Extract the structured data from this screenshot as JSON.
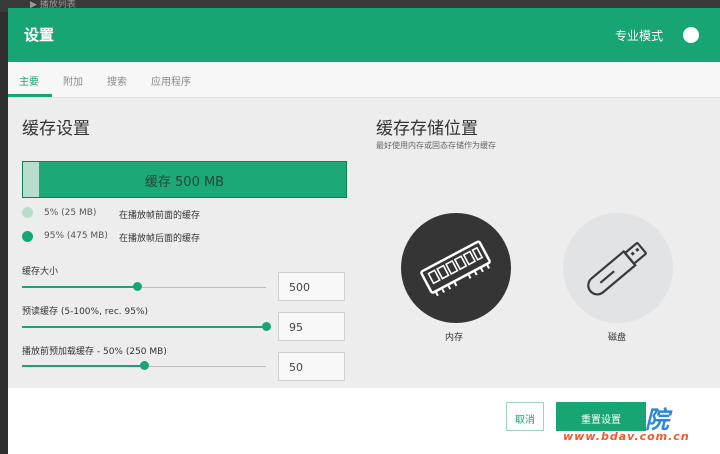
{
  "background": {
    "label": "▶ 播放列表"
  },
  "header": {
    "title": "设置",
    "expert_label": "专业模式"
  },
  "tabs": [
    "主要",
    "附加",
    "搜索",
    "应用程序"
  ],
  "cache": {
    "title": "缓存设置",
    "bar_label": "缓存 500 MB",
    "front_fraction": 0.05,
    "legend": [
      {
        "pct": "5% (25 MB)",
        "desc": "在播放帧前面的缓存"
      },
      {
        "pct": "95% (475 MB)",
        "desc": "在播放帧后面的缓存"
      }
    ],
    "fields": [
      {
        "label": "缓存大小",
        "value": "500",
        "slider_fraction": 0.47
      },
      {
        "label": "预读缓存 (5-100%, rec. 95%)",
        "value": "95",
        "slider_fraction": 1.0
      },
      {
        "label": "播放前预加载缓存 - 50% (250 MB)",
        "value": "50",
        "slider_fraction": 0.5
      }
    ]
  },
  "storage": {
    "title": "缓存存储位置",
    "subtitle": "最好使用内存或固态存储作为缓存",
    "options": [
      {
        "label": "内存",
        "icon": "memory-icon"
      },
      {
        "label": "磁盘",
        "icon": "usb-drive-icon"
      }
    ]
  },
  "footer": {
    "cancel": "取消",
    "primary": "重置设置"
  },
  "watermark": {
    "text": "院",
    "url": "www.bdav.com.cn"
  },
  "colors": {
    "accent": "#17a673",
    "dark_circle": "#353535",
    "light_circle": "#e1e3e4"
  }
}
